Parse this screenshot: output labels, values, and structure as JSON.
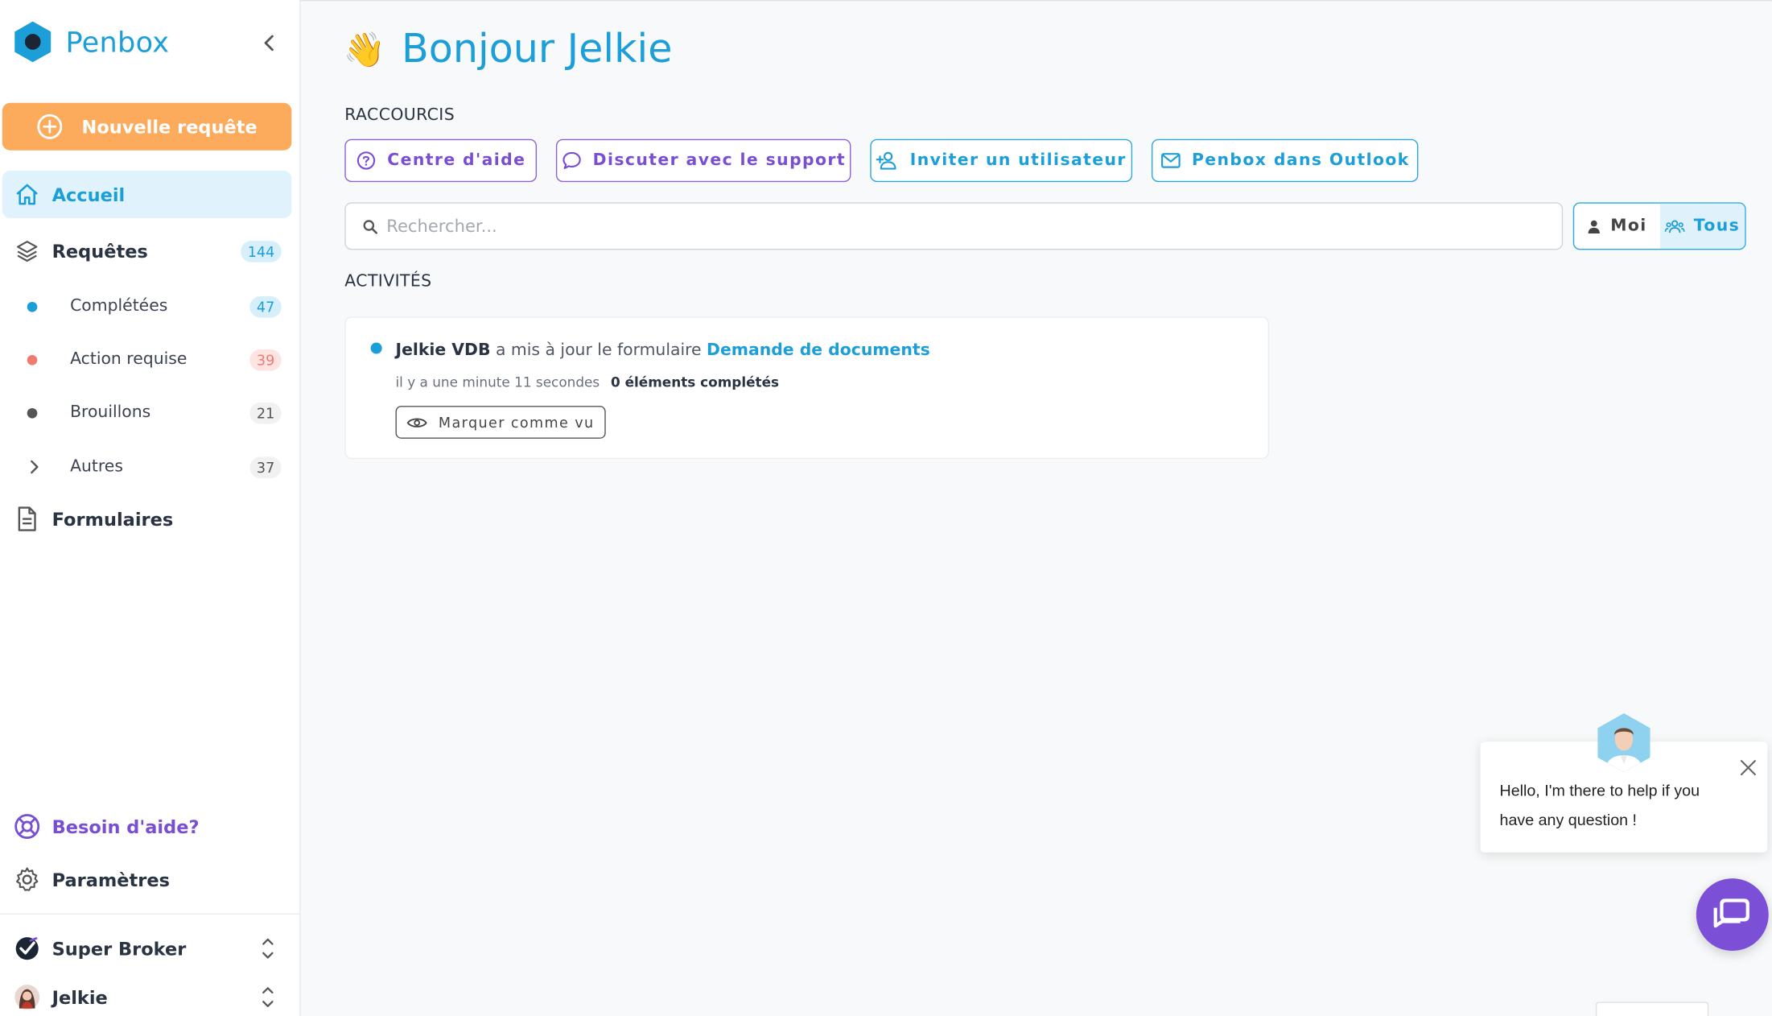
{
  "brand": {
    "name": "Penbox",
    "color": "#1c9fd8"
  },
  "sidebar": {
    "new_request_label": "Nouvelle requête",
    "home_label": "Accueil",
    "requests": {
      "label": "Requêtes",
      "count": "144",
      "children": [
        {
          "label": "Complétées",
          "count": "47",
          "color": "#1c9fd8"
        },
        {
          "label": "Action requise",
          "count": "39",
          "color": "#ef7d6f"
        },
        {
          "label": "Brouillons",
          "count": "21",
          "color": "#555555"
        },
        {
          "label": "Autres",
          "count": "37"
        }
      ]
    },
    "forms_label": "Formulaires",
    "help_label": "Besoin d'aide?",
    "settings_label": "Paramètres",
    "organization": "Super Broker",
    "user": "Jelkie"
  },
  "main": {
    "greeting_emoji": "👋",
    "greeting": "Bonjour Jelkie",
    "shortcuts_title": "RACCOURCIS",
    "shortcuts": [
      {
        "label": "Centre d'aide",
        "icon": "help-circle-icon"
      },
      {
        "label": "Discuter avec le support",
        "icon": "chat-bubble-icon"
      },
      {
        "label": "Inviter un utilisateur",
        "icon": "user-plus-icon"
      },
      {
        "label": "Penbox dans Outlook",
        "icon": "mail-icon"
      }
    ],
    "search_placeholder": "Rechercher...",
    "filter": {
      "me": "Moi",
      "all": "Tous",
      "selected": "Tous"
    },
    "activities_title": "ACTIVITÉS",
    "activity": {
      "user": "Jelkie VDB",
      "action": "a mis à jour le formulaire",
      "target": "Demande de documents",
      "time": "il y a une minute 11 secondes",
      "completed": "0 éléments complétés",
      "mark_seen_label": "Marquer comme vu"
    }
  },
  "chat": {
    "message": "Hello, I'm there to help if you have any question !"
  }
}
